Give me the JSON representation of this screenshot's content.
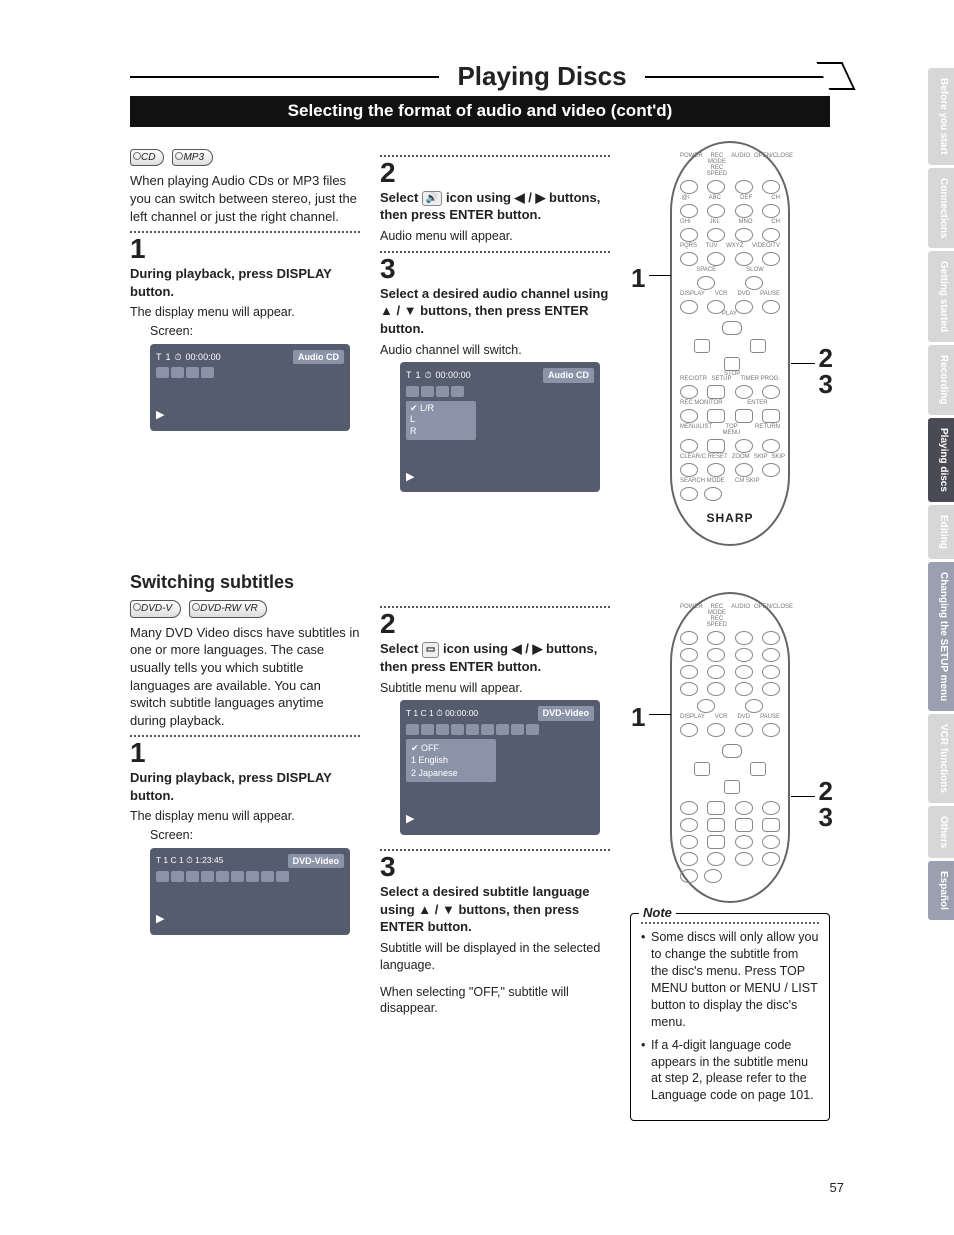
{
  "banner_title": "Playing Discs",
  "subbanner": "Selecting the format of audio and video (cont'd)",
  "section1": {
    "tags": [
      "CD",
      "MP3"
    ],
    "intro": "When playing Audio CDs or MP3 files you can switch between stereo, just the left channel or just the right channel.",
    "step1": {
      "num": "1",
      "title": "During playback, press DISPLAY button.",
      "body": "The display menu will appear.",
      "screen_label": "Screen:"
    },
    "step2": {
      "num": "2",
      "title_a": "Select ",
      "title_b": " icon using ◀ / ▶ buttons, then press ENTER button.",
      "body": "Audio menu will appear."
    },
    "step3": {
      "num": "3",
      "title": "Select a desired audio channel using ▲ / ▼ buttons, then press ENTER button.",
      "body": "Audio channel will switch."
    },
    "osd1": {
      "track": "T",
      "trackno": "1",
      "time": "00:00:00",
      "disclabel": "Audio CD"
    },
    "osd2": {
      "track": "T",
      "trackno": "1",
      "time": "00:00:00",
      "disclabel": "Audio CD",
      "opts": [
        "✔ L/R",
        "   L",
        "   R"
      ]
    }
  },
  "section2": {
    "heading": "Switching subtitles",
    "tags": [
      "DVD-V",
      "DVD-RW VR"
    ],
    "intro": "Many DVD Video discs have subtitles in one or more languages. The case usually tells you which subtitle languages are available. You can switch subtitle languages anytime during playback.",
    "step1": {
      "num": "1",
      "title": "During playback, press DISPLAY button.",
      "body": "The display menu will appear.",
      "screen_label": "Screen:"
    },
    "step2": {
      "num": "2",
      "title_a": "Select ",
      "title_b": " icon using ◀ / ▶ buttons, then press ENTER button.",
      "body": "Subtitle menu will appear."
    },
    "step3": {
      "num": "3",
      "title": "Select a desired subtitle language using ▲ / ▼ buttons, then press ENTER button.",
      "body1": "Subtitle will be displayed in the selected language.",
      "body2": "When selecting \"OFF,\" subtitle will disappear."
    },
    "osd1": {
      "line": "T   1  C   1 ⏱  1:23:45",
      "disclabel": "DVD-Video"
    },
    "osd2": {
      "line": "T   1  C   1 ⏱  00:00:00",
      "disclabel": "DVD-Video",
      "opts": [
        "✔  OFF",
        "   1 English",
        "   2 Japanese"
      ]
    }
  },
  "remote": {
    "row_labels": [
      "POWER",
      "REC MODE REC SPEED",
      "AUDIO",
      "OPEN/CLOSE"
    ],
    "num_labels": [
      ".@/",
      "ABC",
      "DEF",
      "CH"
    ],
    "num_labels2": [
      "GHI",
      "JKL",
      "MNO",
      "CH"
    ],
    "num_labels3": [
      "PQRS",
      "TUV",
      "WXYZ",
      "VIDEO/TV"
    ],
    "space": "SPACE",
    "slow": "SLOW",
    "row4": [
      "DISPLAY",
      "VCR",
      "DVD",
      "PAUSE"
    ],
    "play": "PLAY",
    "stop": "STOP",
    "row5": [
      "REC/OTR",
      "SETUP",
      "",
      "TIMER PROG."
    ],
    "row6": [
      "REC MONITOR",
      "",
      "ENTER",
      ""
    ],
    "row7": [
      "MENU/LIST",
      "TOP MENU",
      "",
      "RETURN"
    ],
    "row8": [
      "CLEAR/C.RESET",
      "ZOOM",
      "SKIP",
      "SKIP"
    ],
    "row9": [
      "SEARCH MODE",
      "CM SKIP",
      "",
      ""
    ],
    "brand": "SHARP"
  },
  "callouts": {
    "c1": "1",
    "c2": "2",
    "c3": "3"
  },
  "note": {
    "title": "Note",
    "items": [
      "Some discs will only allow you to change the subtitle from the disc's menu. Press TOP MENU button or MENU / LIST button to display the disc's menu.",
      "If a 4-digit language code appears in the subtitle menu at step 2, please refer to the Language code on page 101."
    ]
  },
  "sidetabs": [
    "Before you start",
    "Connections",
    "Getting started",
    "Recording",
    "Playing discs",
    "Editing",
    "Changing the SETUP menu",
    "VCR functions",
    "Others",
    "Español"
  ],
  "page_number": "57"
}
